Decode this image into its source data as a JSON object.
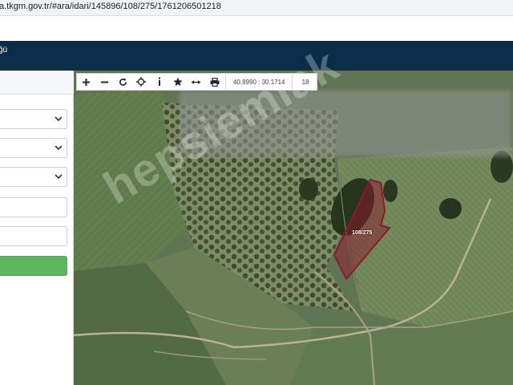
{
  "browser": {
    "url": "a.tkgm.gov.tr/#ara/idari/145896/108/275/1761206501218"
  },
  "header": {
    "title": "ğü"
  },
  "map": {
    "coordinates": "40.8990 : 30.1714",
    "zoom_level": "18",
    "parcel_label": "108/275",
    "watermark": "hepsiemlak",
    "parcel_color": "#8b1a2e"
  },
  "toolbar": {
    "zoom_in_icon": "plus-icon",
    "zoom_out_icon": "minus-icon",
    "refresh_icon": "refresh-icon",
    "locate_icon": "crosshair-icon",
    "info_icon": "info-icon",
    "favorite_icon": "star-icon",
    "measure_icon": "ruler-icon",
    "print_icon": "print-icon"
  },
  "colors": {
    "header_bg": "#0c2d48",
    "search_button": "#5cb85c"
  }
}
